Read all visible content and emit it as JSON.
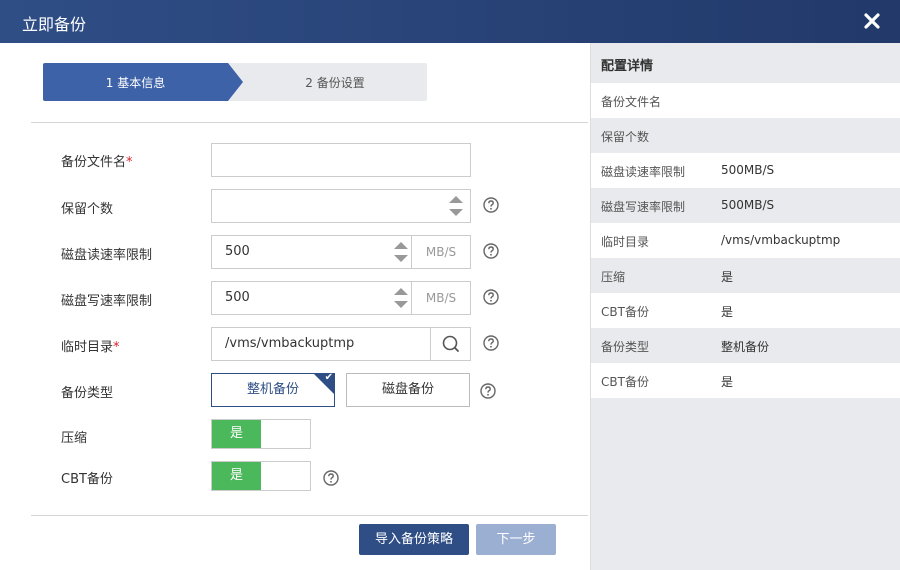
{
  "dialog": {
    "title": "立即备份"
  },
  "steps": [
    {
      "label": "1 基本信息"
    },
    {
      "label": "2 备份设置"
    }
  ],
  "form": {
    "backup_filename": {
      "label": "备份文件名",
      "required_mark": "*",
      "value": ""
    },
    "retention_count": {
      "label": "保留个数",
      "value": ""
    },
    "disk_read_limit": {
      "label": "磁盘读速率限制",
      "value": "500",
      "unit": "MB/S"
    },
    "disk_write_limit": {
      "label": "磁盘写速率限制",
      "value": "500",
      "unit": "MB/S"
    },
    "temp_dir": {
      "label": "临时目录",
      "required_mark": "*",
      "value": "/vms/vmbackuptmp"
    },
    "backup_type": {
      "label": "备份类型",
      "options": [
        "整机备份",
        "磁盘备份"
      ],
      "selected": "整机备份"
    },
    "compression": {
      "label": "压缩",
      "toggle_on_label": "是"
    },
    "cbt_backup": {
      "label": "CBT备份",
      "toggle_on_label": "是"
    }
  },
  "buttons": {
    "import_policy": "导入备份策略",
    "next": "下一步"
  },
  "details": {
    "title": "配置详情",
    "rows": [
      {
        "key": "备份文件名",
        "value": ""
      },
      {
        "key": "保留个数",
        "value": ""
      },
      {
        "key": "磁盘读速率限制",
        "value": "500MB/S"
      },
      {
        "key": "磁盘写速率限制",
        "value": "500MB/S"
      },
      {
        "key": "临时目录",
        "value": "/vms/vmbackuptmp"
      },
      {
        "key": "压缩",
        "value": "是"
      },
      {
        "key": "CBT备份",
        "value": "是"
      },
      {
        "key": "备份类型",
        "value": "整机备份"
      },
      {
        "key": "CBT备份",
        "value": "是"
      }
    ]
  },
  "colors": {
    "primary": "#2f4e86",
    "step_active": "#3d62a8",
    "toggle_on": "#4cb85c",
    "required": "#d9232d",
    "next_disabled": "#9bafd3",
    "panel_bg": "#e9eaed"
  },
  "icons": {
    "close": "close-icon",
    "help": "question-circle-icon",
    "search": "search-icon",
    "check": "check-icon",
    "spin_up": "caret-up-icon",
    "spin_down": "caret-down-icon"
  }
}
